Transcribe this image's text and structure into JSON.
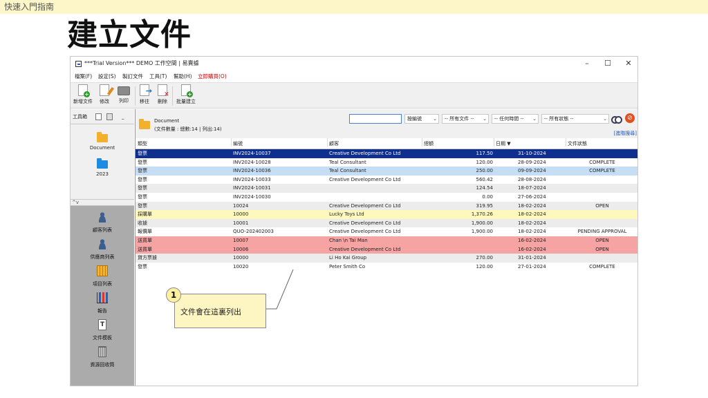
{
  "slide": {
    "header": "快速入門指南",
    "title": "建立文件",
    "callout_number": "1",
    "callout_text": "文件會在這裏列出"
  },
  "window": {
    "title": "***Trial Version*** DEMO 工作空間 | 易賣據",
    "minimize": "–",
    "maximize": "☐",
    "close": "✕"
  },
  "menu": {
    "file": "檔案(F)",
    "settings": "設定(S)",
    "create": "製訂文件",
    "tools": "工具(T)",
    "help": "幫助(H)",
    "buy": "立即購買(O)"
  },
  "toolbar": {
    "new": "新增文件",
    "edit": "修改",
    "print": "列印",
    "move": "移往",
    "delete": "刪除",
    "batch": "批量建立"
  },
  "sidebar": {
    "header": "工具箱",
    "minimize": "_",
    "folders": [
      "Document",
      "2023"
    ],
    "collapse": "^v",
    "nav": [
      "顧客列表",
      "供應商列表",
      "項目列表",
      "報告",
      "文件模板",
      "資源回收筒"
    ]
  },
  "main": {
    "folder_title": "Document",
    "count_text": "(文件數量 : 總數:14 | 列出:14)",
    "search_value": "",
    "filters": [
      "按編號",
      "-- 所有文件 --",
      "-- 任何時間 --",
      "-- 所有狀態 --"
    ],
    "advanced_link": "[進階搜尋]"
  },
  "table": {
    "columns": [
      "類型",
      "編號",
      "顧客",
      "總額",
      "日期 ▼",
      "文件狀態"
    ],
    "rows": [
      {
        "type": "發票",
        "no": "INV2024-10037",
        "customer": "Creative Development Co Ltd",
        "total": "117.50",
        "date": "31-10-2024",
        "status": "",
        "style": "sel"
      },
      {
        "type": "發票",
        "no": "INV2024-10028",
        "customer": "Teal Consultant",
        "total": "120.00",
        "date": "28-09-2024",
        "status": "COMPLETE",
        "style": ""
      },
      {
        "type": "發票",
        "no": "INV2024-10036",
        "customer": "Teal Consultant",
        "total": "250.00",
        "date": "09-09-2024",
        "status": "COMPLETE",
        "style": "lblue"
      },
      {
        "type": "發票",
        "no": "INV2024-10033",
        "customer": "Creative Development Co Ltd",
        "total": "560.42",
        "date": "28-08-2024",
        "status": "",
        "style": ""
      },
      {
        "type": "發票",
        "no": "INV2024-10031",
        "customer": "",
        "total": "124.54",
        "date": "18-07-2024",
        "status": "",
        "style": "alt"
      },
      {
        "type": "發票",
        "no": "INV2024-10030",
        "customer": "",
        "total": "0.00",
        "date": "27-06-2024",
        "status": "",
        "style": ""
      },
      {
        "type": "發票",
        "no": "10024",
        "customer": "Creative Development Co Ltd",
        "total": "319.95",
        "date": "18-02-2024",
        "status": "OPEN",
        "style": "alt"
      },
      {
        "type": "採購單",
        "no": "10000",
        "customer": "Lucky Toys Ltd",
        "total": "1,370.26",
        "date": "18-02-2024",
        "status": "",
        "style": "yellow"
      },
      {
        "type": "收據",
        "no": "10001",
        "customer": "Creative Development Co Ltd",
        "total": "1,900.00",
        "date": "18-02-2024",
        "status": "",
        "style": "alt"
      },
      {
        "type": "報價單",
        "no": "QUO-202402003",
        "customer": "Creative Development Co Ltd",
        "total": "1,900.00",
        "date": "18-02-2024",
        "status": "PENDING APPROVAL",
        "style": ""
      },
      {
        "type": "送貨單",
        "no": "10007",
        "customer": "Chan \\n Tai Man",
        "total": "",
        "date": "16-02-2024",
        "status": "OPEN",
        "style": "red"
      },
      {
        "type": "送貨單",
        "no": "10006",
        "customer": "Creative Development Co Ltd",
        "total": "",
        "date": "16-02-2024",
        "status": "OPEN",
        "style": "red"
      },
      {
        "type": "貸方票據",
        "no": "10000",
        "customer": "Li Ho Kai Group",
        "total": "270.00",
        "date": "31-01-2024",
        "status": "",
        "style": "alt"
      },
      {
        "type": "發票",
        "no": "10020",
        "customer": "Peter Smith Co",
        "total": "120.00",
        "date": "27-01-2024",
        "status": "COMPLETE",
        "style": ""
      }
    ]
  }
}
